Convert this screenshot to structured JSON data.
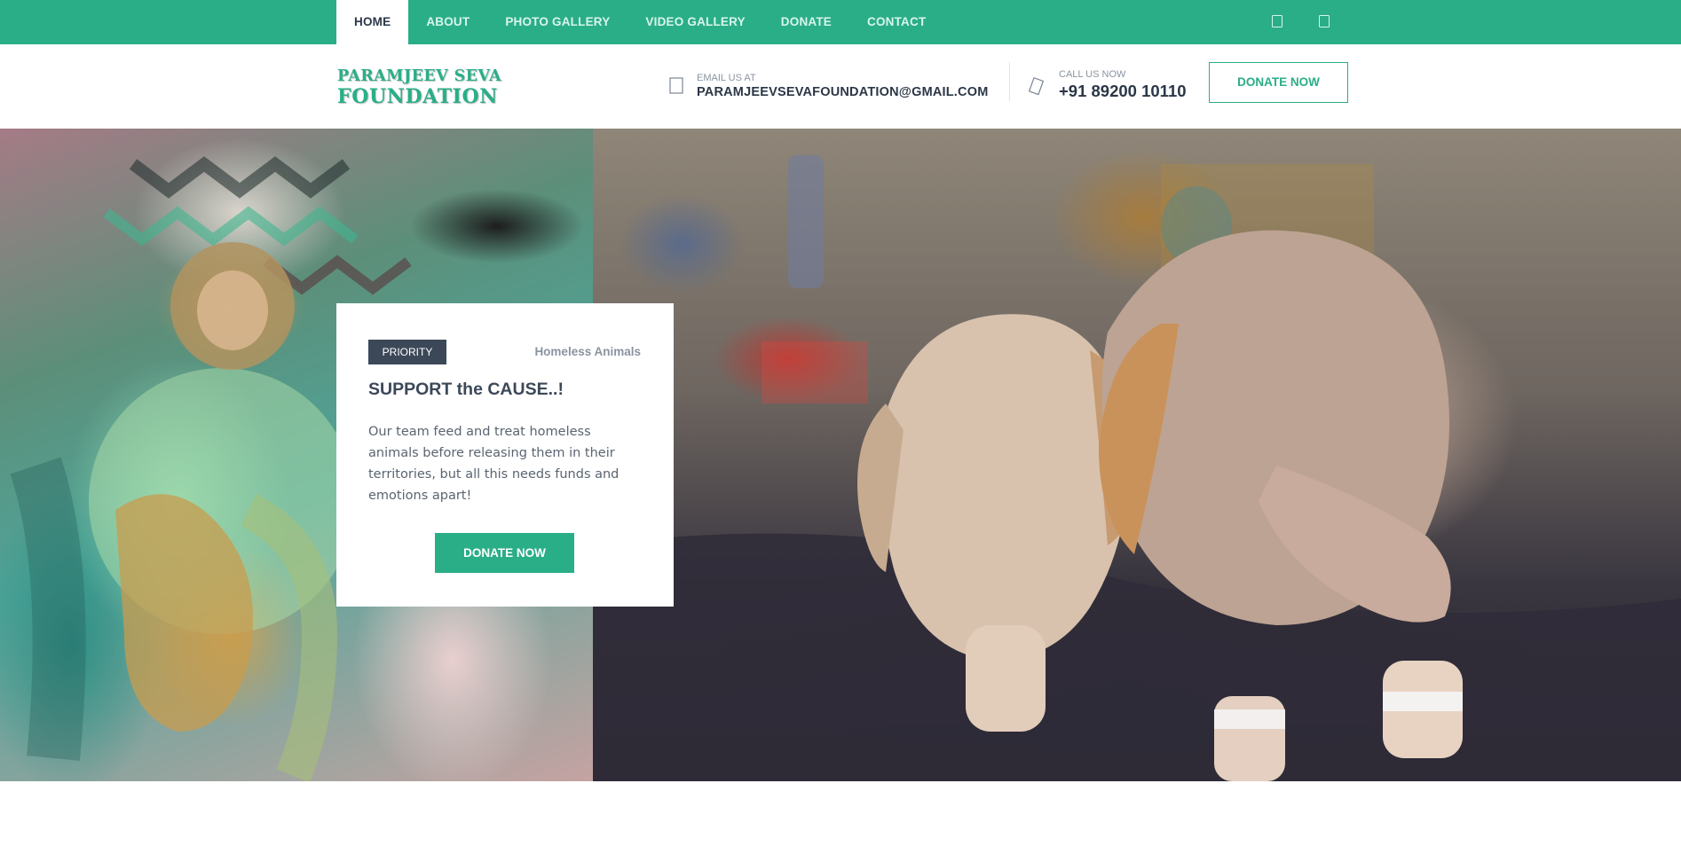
{
  "nav": {
    "items": [
      {
        "label": "HOME",
        "active": true
      },
      {
        "label": "ABOUT",
        "active": false
      },
      {
        "label": "PHOTO GALLERY",
        "active": false
      },
      {
        "label": "VIDEO GALLERY",
        "active": false
      },
      {
        "label": "DONATE",
        "active": false
      },
      {
        "label": "CONTACT",
        "active": false
      }
    ],
    "social_icons": [
      "facebook-icon",
      "instagram-icon"
    ]
  },
  "header": {
    "logo_line1": "PARAMJEEV SEVA",
    "logo_line2": "FOUNDATION",
    "email_label": "EMAIL US AT",
    "email_value": "PARAMJEEVSEVAFOUNDATION@GMAIL.COM",
    "phone_label": "CALL US NOW",
    "phone_value": "+91 89200 10110",
    "donate_label": "DONATE NOW"
  },
  "hero": {
    "badge": "PRIORITY",
    "category": "Homeless Animals",
    "title": "SUPPORT the CAUSE..!",
    "text": "Our team feed and treat homeless animals before releasing them in their territories, but all this needs funds and emotions apart!",
    "button_label": "DONATE NOW",
    "slides": 3,
    "active_slide": 1
  },
  "colors": {
    "brand": "#2aae88",
    "dark": "#3c4858",
    "muted": "#8a94a0"
  }
}
